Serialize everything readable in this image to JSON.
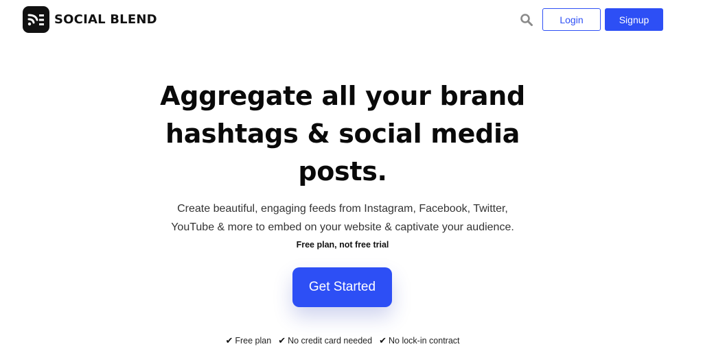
{
  "brand": {
    "name": "SOCIAL BLEND",
    "logo_icon": "social-blend-logo-icon"
  },
  "header": {
    "search_icon": "search-icon",
    "login_label": "Login",
    "signup_label": "Signup"
  },
  "hero": {
    "title_lines": [
      "Aggregate all your brand",
      "hashtags & social media",
      "posts."
    ],
    "subtitle_lines": [
      "Create beautiful, engaging feeds from Instagram, Facebook, Twitter,",
      "YouTube & more to embed on your website & captivate your audience."
    ],
    "free_note": "Free plan, not free trial",
    "cta_label": "Get Started"
  },
  "perks": [
    {
      "icon": "check-icon",
      "label": "Free plan"
    },
    {
      "icon": "check-icon",
      "label": "No credit card needed"
    },
    {
      "icon": "check-icon",
      "label": "No lock-in contract"
    }
  ],
  "colors": {
    "accent": "#2d4ff5",
    "text": "#111111",
    "background": "#ffffff"
  }
}
